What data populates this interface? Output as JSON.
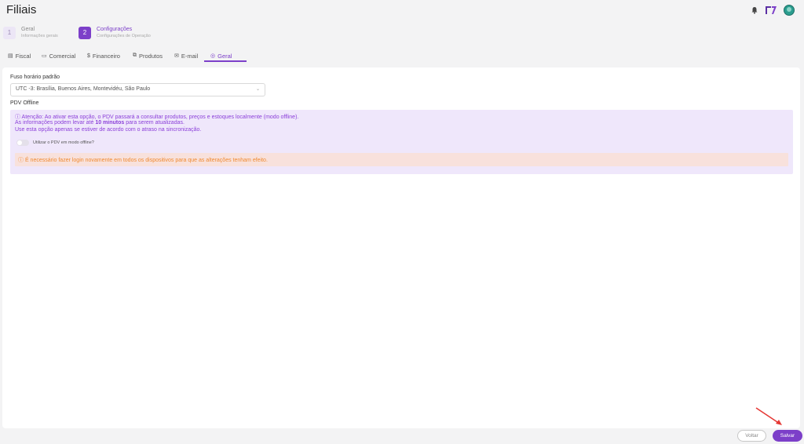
{
  "header": {
    "title": "Filiais"
  },
  "steps": [
    {
      "number": "1",
      "title": "Geral",
      "subtitle": "Informações gerais"
    },
    {
      "number": "2",
      "title": "Configurações",
      "subtitle": "Configurações de Operação"
    }
  ],
  "tabs": [
    {
      "icon": "▤",
      "label": "Fiscal"
    },
    {
      "icon": "▭",
      "label": "Comercial"
    },
    {
      "icon": "$",
      "label": "Financeiro"
    },
    {
      "icon": "⧉",
      "label": "Produtos"
    },
    {
      "icon": "✉",
      "label": "E-mail"
    },
    {
      "icon": "◎",
      "label": "Geral"
    }
  ],
  "active_tab": "Geral",
  "form": {
    "timezone_label": "Fuso horário padrão",
    "timezone_value": "UTC -3: Brasília, Buenos Aires, Montevidéu, São Paulo",
    "pdv_label": "PDV Offline",
    "notice": {
      "line1": "ⓘ Atenção: Ao ativar esta opção, o PDV passará a consultar produtos, preços e estoques localmente (modo offline).",
      "line2_prefix": "As informações podem levar até ",
      "line2_bold": "10 minutos",
      "line2_suffix": " para serem atualizadas.",
      "line3": "Use esta opção apenas se estiver de acordo com o atraso na sincronização."
    },
    "toggle_label": "Utilizar o PDV em modo offline?",
    "toggle_on": false,
    "warning": "ⓘ É necessário fazer login novamente em todos os dispositivos para que as alterações tenham efeito."
  },
  "footer": {
    "back_label": "Voltar",
    "save_label": "Salvar"
  },
  "colors": {
    "accent": "#7c3fc9",
    "notice_bg": "#efe7fb",
    "warning_bg": "#f8e1dc",
    "warning_text": "#f08a30"
  }
}
